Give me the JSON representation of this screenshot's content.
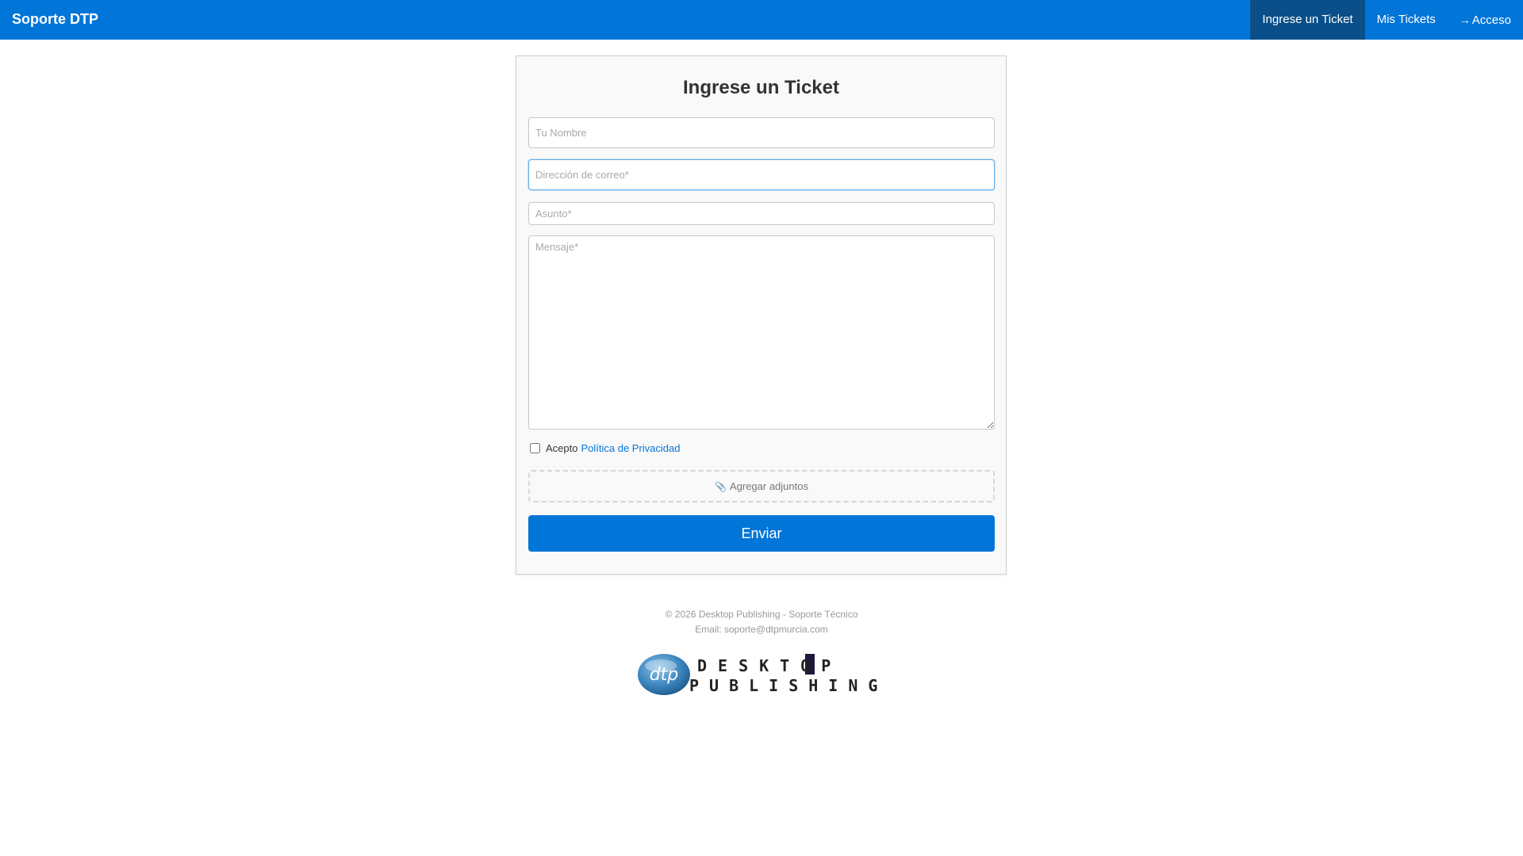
{
  "navbar": {
    "brand": "Soporte DTP",
    "items": [
      {
        "label": "Ingrese un Ticket",
        "active": true
      },
      {
        "label": "Mis Tickets",
        "active": false
      },
      {
        "label": "Acceso",
        "icon": "sign-in-icon",
        "active": false
      }
    ],
    "color": "#0275d8",
    "active_color": "#0a4f8a"
  },
  "form": {
    "title": "Ingrese un Ticket",
    "name_placeholder": "Tu Nombre",
    "email_placeholder": "Dirección de correo*",
    "subject_placeholder": "Asunto*",
    "message_placeholder": "Mensaje*",
    "privacy_text": "Acepto",
    "privacy_link": "Política de Privacidad",
    "attach_label": "Agregar adjuntos",
    "attach_icon": "paperclip-icon",
    "submit_label": "Enviar"
  },
  "footer": {
    "line1": "© 2026 Desktop Publishing - Soporte Técnico",
    "line2": "Email: soporte@dtpmurcia.com"
  },
  "logo": {
    "mark": "dtp",
    "line1": "DESKTOP",
    "line2": "PUBLISHING"
  }
}
